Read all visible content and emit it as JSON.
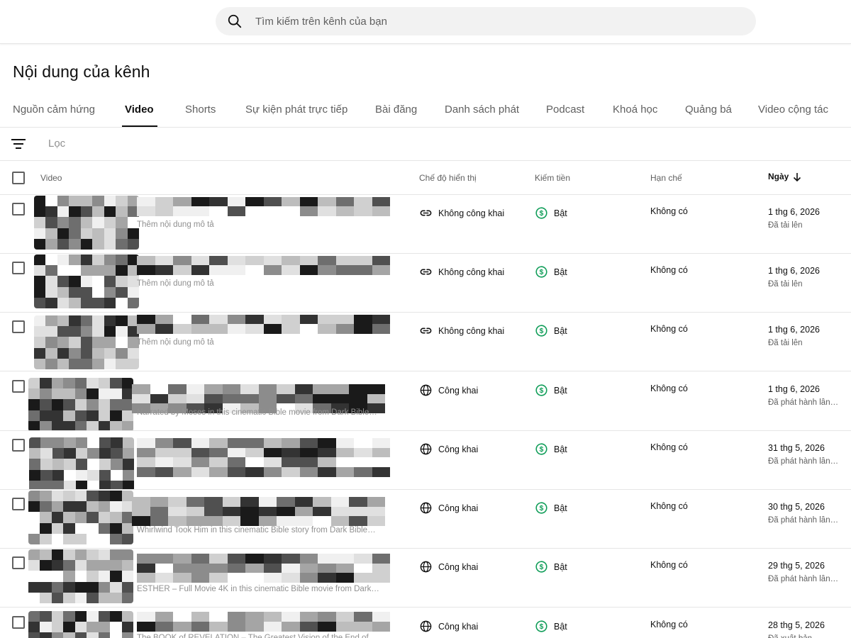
{
  "search": {
    "placeholder": "Tìm kiếm trên kênh của bạn"
  },
  "page_title": "Nội dung của kênh",
  "tabs": [
    {
      "label": "Nguồn cảm hứng"
    },
    {
      "label": "Video"
    },
    {
      "label": "Shorts"
    },
    {
      "label": "Sự kiện phát trực tiếp"
    },
    {
      "label": "Bài đăng"
    },
    {
      "label": "Danh sách phát"
    },
    {
      "label": "Podcast"
    },
    {
      "label": "Khoá học"
    },
    {
      "label": "Quảng bá"
    },
    {
      "label": "Video cộng tác"
    }
  ],
  "active_tab": "Video",
  "filter": {
    "placeholder": "Lọc"
  },
  "columns": {
    "video": "Video",
    "visibility": "Chế độ hiển thị",
    "monetization": "Kiếm tiền",
    "restrictions": "Hạn chế",
    "date": "Ngày"
  },
  "colors": {
    "monetization_green": "#0f9d58",
    "active_text": "#0f0f0f",
    "muted_text": "#606060"
  },
  "rows": [
    {
      "description": "Thêm nội dung mô tả",
      "visibility": "Không công khai",
      "visibility_icon": "link-icon",
      "monetization": "Bật",
      "restrictions": "Không có",
      "date": "1 thg 6, 2026",
      "date_status": "Đã tải lên"
    },
    {
      "description": "Thêm nội dung mô tả",
      "visibility": "Không công khai",
      "visibility_icon": "link-icon",
      "monetization": "Bật",
      "restrictions": "Không có",
      "date": "1 thg 6, 2026",
      "date_status": "Đã tải lên"
    },
    {
      "description": "Thêm nội dung mô tả",
      "visibility": "Không công khai",
      "visibility_icon": "link-icon",
      "monetization": "Bật",
      "restrictions": "Không có",
      "date": "1 thg 6, 2026",
      "date_status": "Đã tải lên"
    },
    {
      "description": "Narrated by Moses in this cinematic Bible movie from Dark Bible…",
      "visibility": "Công khai",
      "visibility_icon": "globe-icon",
      "monetization": "Bật",
      "restrictions": "Không có",
      "date": "1 thg 6, 2026",
      "date_status": "Đã phát hành lần…"
    },
    {
      "description": "",
      "visibility": "Công khai",
      "visibility_icon": "globe-icon",
      "monetization": "Bật",
      "restrictions": "Không có",
      "date": "31 thg 5, 2026",
      "date_status": "Đã phát hành lần…"
    },
    {
      "description": "Whirlwind Took Him in this cinematic Bible story from Dark Bible…",
      "visibility": "Công khai",
      "visibility_icon": "globe-icon",
      "monetization": "Bật",
      "restrictions": "Không có",
      "date": "30 thg 5, 2026",
      "date_status": "Đã phát hành lần…"
    },
    {
      "description": "ESTHER – Full Movie 4K in this cinematic Bible movie from Dark…",
      "visibility": "Công khai",
      "visibility_icon": "globe-icon",
      "monetization": "Bật",
      "restrictions": "Không có",
      "date": "29 thg 5, 2026",
      "date_status": "Đã phát hành lần…"
    },
    {
      "description": "The BOOK of REVELATION – The Greatest Vision of the End of…",
      "visibility": "Công khai",
      "visibility_icon": "globe-icon",
      "monetization": "Bật",
      "restrictions": "Không có",
      "date": "28 thg 5, 2026",
      "date_status": "Đã xuất bản"
    }
  ]
}
